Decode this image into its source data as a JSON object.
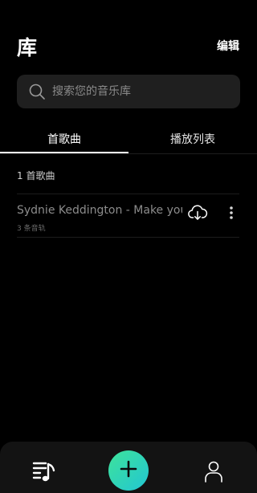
{
  "header": {
    "title": "库",
    "edit_label": "编辑"
  },
  "search": {
    "placeholder": "搜索您的音乐库",
    "value": ""
  },
  "tabs": [
    {
      "label": "首歌曲",
      "active": true
    },
    {
      "label": "播放列表",
      "active": false
    }
  ],
  "songs_section": {
    "count_label": "1 首歌曲",
    "items": [
      {
        "title": "Sydnie Keddington - Make your",
        "subtitle": "3 条音轨"
      }
    ]
  },
  "bottom_nav": {
    "icons": [
      "library-music-icon",
      "plus-icon",
      "profile-icon"
    ],
    "accent_colors": [
      "#3ee39a",
      "#22c6d3"
    ]
  }
}
